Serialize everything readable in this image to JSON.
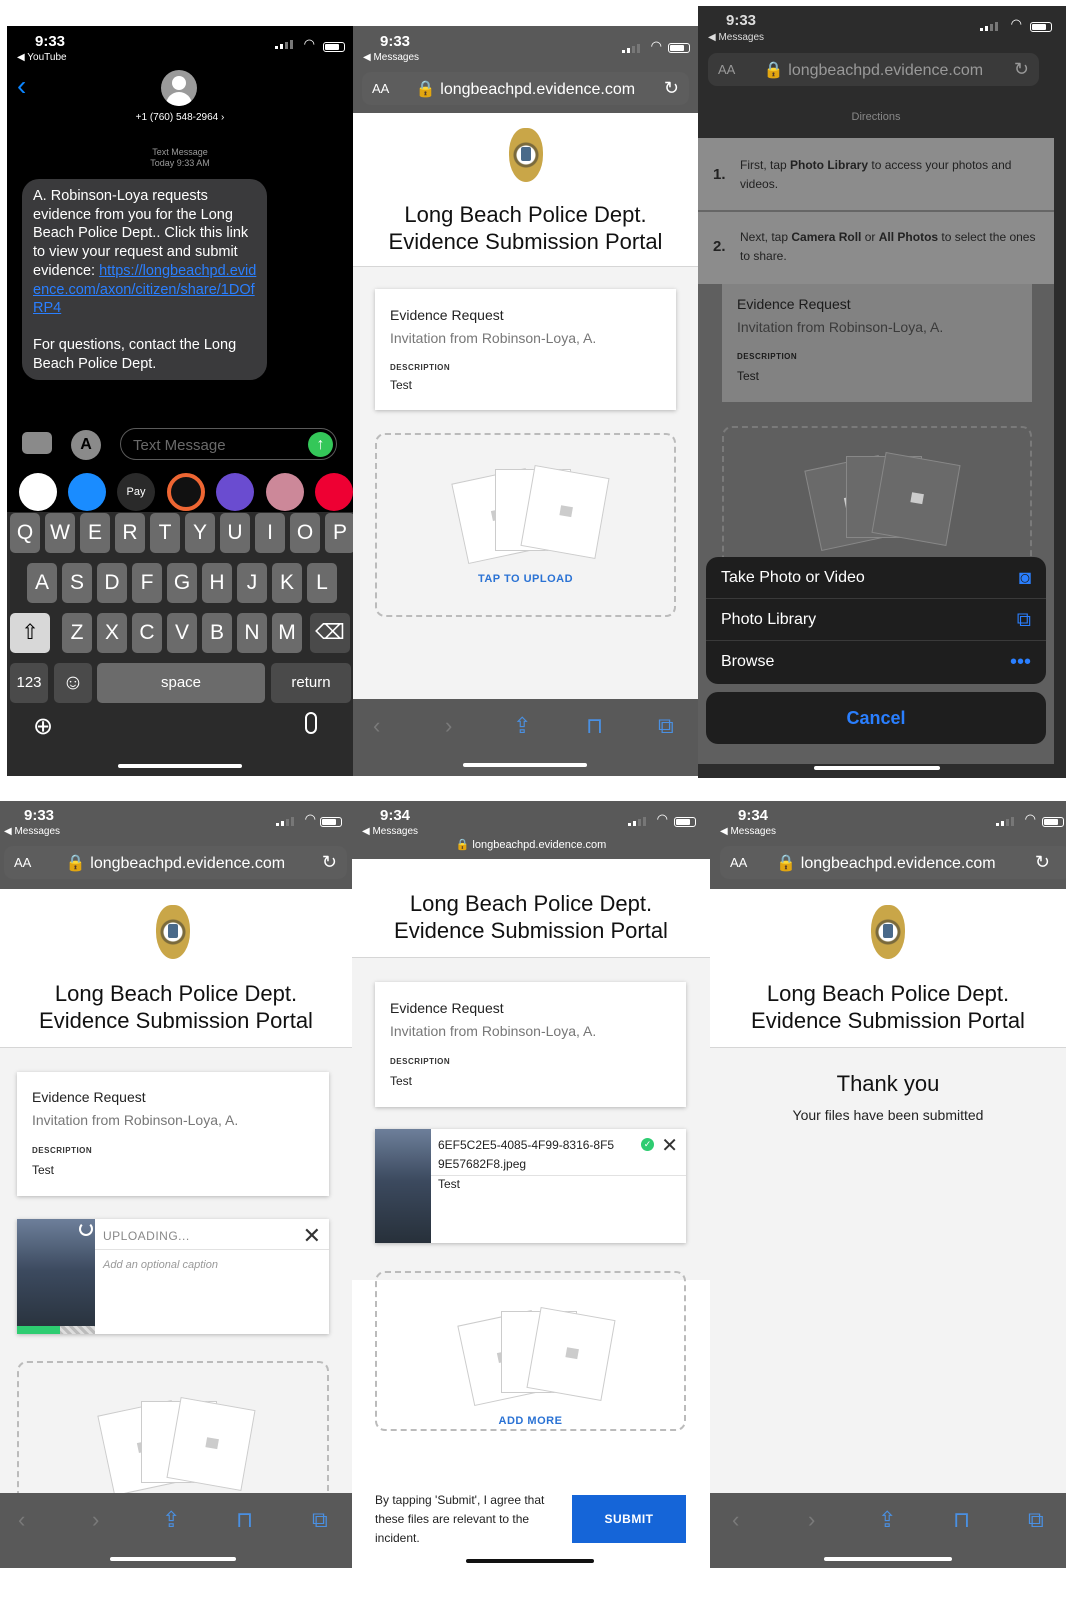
{
  "panels": {
    "p1": {
      "time": "9:33",
      "back_app": "◀ YouTube",
      "contact": "+1 (760) 548-2964",
      "msg_meta": "Text Message",
      "msg_time": "Today 9:33 AM",
      "message_pre": "A. Robinson-Loya requests evidence from you for the Long Beach Police Dept.. Click this link to view your request and submit evidence: ",
      "message_link": "https://longbeachpd.evidence.com/axon/citizen/share/1DOfRP4",
      "message_post": "For questions, contact the Long Beach Police Dept.",
      "input_placeholder": "Text Message",
      "keyboard_rows": [
        [
          "Q",
          "W",
          "E",
          "R",
          "T",
          "Y",
          "U",
          "I",
          "O",
          "P"
        ],
        [
          "A",
          "S",
          "D",
          "F",
          "G",
          "H",
          "J",
          "K",
          "L"
        ],
        [
          "Z",
          "X",
          "C",
          "V",
          "B",
          "N",
          "M"
        ]
      ],
      "key_123": "123",
      "key_space": "space",
      "key_return": "return",
      "apple_pay": "Pay"
    },
    "p2": {
      "time": "9:33",
      "back_app": "◀ Messages",
      "url_aa": "AA",
      "url": "longbeachpd.evidence.com",
      "title1": "Long Beach Police Dept.",
      "title2": "Evidence Submission Portal",
      "card_heading": "Evidence Request",
      "card_inv": "Invitation from Robinson-Loya, A.",
      "desc_label": "DESCRIPTION",
      "desc_value": "Test",
      "upload_label": "TAP TO UPLOAD"
    },
    "p3": {
      "time": "9:33",
      "back_app": "◀ Messages",
      "url_aa": "AA",
      "url": "longbeachpd.evidence.com",
      "directions_label": "Directions",
      "step1_num": "1.",
      "step1_a": "First, tap ",
      "step1_bold": "Photo Library",
      "step1_b": " to access your photos and videos.",
      "step2_num": "2.",
      "step2_a": "Next, tap ",
      "step2_bold1": "Camera Roll",
      "step2_or": " or ",
      "step2_bold2": "All Photos",
      "step2_b": " to select the ones to share.",
      "card_heading": "Evidence Request",
      "card_inv": "Invitation from Robinson-Loya, A.",
      "desc_label": "DESCRIPTION",
      "desc_value": "Test",
      "menu": [
        "Take Photo or Video",
        "Photo Library",
        "Browse"
      ],
      "cancel": "Cancel"
    },
    "p4": {
      "time": "9:33",
      "back_app": "◀ Messages",
      "url_aa": "AA",
      "url": "longbeachpd.evidence.com",
      "title1": "Long Beach Police Dept.",
      "title2": "Evidence Submission Portal",
      "card_heading": "Evidence Request",
      "card_inv": "Invitation from Robinson-Loya, A.",
      "desc_label": "DESCRIPTION",
      "desc_value": "Test",
      "uploading": "UPLOADING...",
      "caption_placeholder": "Add an optional caption",
      "upload_progress": 0.55
    },
    "p5": {
      "time": "9:34",
      "back_app": "◀ Messages",
      "url": "longbeachpd.evidence.com",
      "title1": "Long Beach Police Dept.",
      "title2": "Evidence Submission Portal",
      "card_heading": "Evidence Request",
      "card_inv": "Invitation from Robinson-Loya, A.",
      "desc_label": "DESCRIPTION",
      "desc_value": "Test",
      "file_name1": "6EF5C2E5-4085-4F99-8316-8F5",
      "file_name2": "9E57682F8.jpeg",
      "file_caption": "Test",
      "add_more": "ADD MORE",
      "consent": "By tapping 'Submit', I agree that these files are relevant to the incident.",
      "submit": "SUBMIT"
    },
    "p6": {
      "time": "9:34",
      "back_app": "◀ Messages",
      "url_aa": "AA",
      "url": "longbeachpd.evidence.com",
      "title1": "Long Beach Police Dept.",
      "title2": "Evidence Submission Portal",
      "thank_you": "Thank you",
      "submitted": "Your files have been submitted"
    }
  },
  "colors": {
    "link_blue": "#2a72d4",
    "ios_blue": "#0a84ff",
    "submit_blue": "#1565d8",
    "success_green": "#2ecc71",
    "progress_green": "#2ecc71"
  }
}
